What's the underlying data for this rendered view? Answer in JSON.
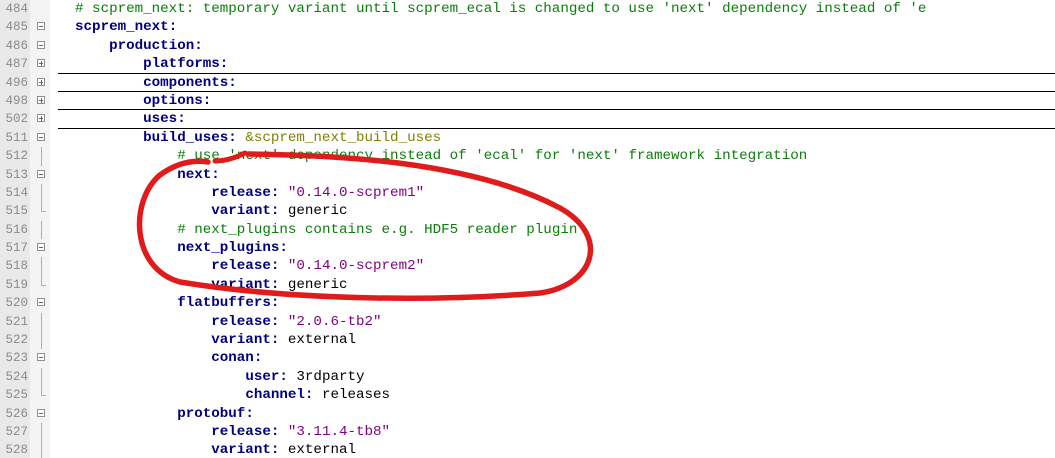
{
  "editor": {
    "lines": [
      {
        "num": "484",
        "fold": "none",
        "folded": false,
        "indent": 2,
        "segments": [
          {
            "t": "# scprem_next: temporary variant until scprem_ecal is changed to use 'next' dependency instead of 'e",
            "c": "c"
          }
        ]
      },
      {
        "num": "485",
        "fold": "open",
        "folded": false,
        "indent": 2,
        "segments": [
          {
            "t": "scprem_next",
            "c": "k"
          },
          {
            "t": ":",
            "c": "k"
          }
        ]
      },
      {
        "num": "486",
        "fold": "open",
        "folded": false,
        "indent": 6,
        "segments": [
          {
            "t": "production",
            "c": "k"
          },
          {
            "t": ":",
            "c": "k"
          }
        ]
      },
      {
        "num": "487",
        "fold": "closed",
        "folded": true,
        "indent": 10,
        "segments": [
          {
            "t": "platforms",
            "c": "k"
          },
          {
            "t": ":",
            "c": "k"
          }
        ]
      },
      {
        "num": "496",
        "fold": "closed",
        "folded": true,
        "indent": 10,
        "segments": [
          {
            "t": "components",
            "c": "k"
          },
          {
            "t": ":",
            "c": "k"
          }
        ]
      },
      {
        "num": "498",
        "fold": "closed",
        "folded": true,
        "indent": 10,
        "segments": [
          {
            "t": "options",
            "c": "k"
          },
          {
            "t": ":",
            "c": "k"
          }
        ]
      },
      {
        "num": "502",
        "fold": "closed",
        "folded": true,
        "indent": 10,
        "segments": [
          {
            "t": "uses",
            "c": "k"
          },
          {
            "t": ":",
            "c": "k"
          }
        ]
      },
      {
        "num": "511",
        "fold": "open",
        "folded": false,
        "indent": 10,
        "segments": [
          {
            "t": "build_uses",
            "c": "k"
          },
          {
            "t": ": ",
            "c": "k"
          },
          {
            "t": "&scprem_next_build_uses",
            "c": "a"
          }
        ]
      },
      {
        "num": "512",
        "fold": "none",
        "folded": false,
        "indent": 14,
        "segments": [
          {
            "t": "# use 'next' dependency instead of 'ecal' for 'next' framework integration",
            "c": "c"
          }
        ]
      },
      {
        "num": "513",
        "fold": "open",
        "folded": false,
        "indent": 14,
        "segments": [
          {
            "t": "next",
            "c": "k"
          },
          {
            "t": ":",
            "c": "k"
          }
        ]
      },
      {
        "num": "514",
        "fold": "none",
        "folded": false,
        "indent": 18,
        "segments": [
          {
            "t": "release",
            "c": "k"
          },
          {
            "t": ": ",
            "c": "k"
          },
          {
            "t": "\"0.14.0-scprem1\"",
            "c": "s"
          }
        ]
      },
      {
        "num": "515",
        "fold": "end",
        "folded": false,
        "indent": 18,
        "segments": [
          {
            "t": "variant",
            "c": "k"
          },
          {
            "t": ": ",
            "c": "k"
          },
          {
            "t": "generic",
            "c": "v"
          }
        ]
      },
      {
        "num": "516",
        "fold": "none",
        "folded": false,
        "indent": 14,
        "segments": [
          {
            "t": "# next_plugins contains e.g. HDF5 reader plugin",
            "c": "c"
          }
        ]
      },
      {
        "num": "517",
        "fold": "open",
        "folded": false,
        "indent": 14,
        "segments": [
          {
            "t": "next_plugins",
            "c": "k"
          },
          {
            "t": ":",
            "c": "k"
          }
        ]
      },
      {
        "num": "518",
        "fold": "none",
        "folded": false,
        "indent": 18,
        "segments": [
          {
            "t": "release",
            "c": "k"
          },
          {
            "t": ": ",
            "c": "k"
          },
          {
            "t": "\"0.14.0-scprem2\"",
            "c": "s"
          }
        ]
      },
      {
        "num": "519",
        "fold": "end",
        "folded": false,
        "indent": 18,
        "segments": [
          {
            "t": "variant",
            "c": "k"
          },
          {
            "t": ": ",
            "c": "k"
          },
          {
            "t": "generic",
            "c": "v"
          }
        ]
      },
      {
        "num": "520",
        "fold": "open",
        "folded": false,
        "indent": 14,
        "segments": [
          {
            "t": "flatbuffers",
            "c": "k"
          },
          {
            "t": ":",
            "c": "k"
          }
        ]
      },
      {
        "num": "521",
        "fold": "none",
        "folded": false,
        "indent": 18,
        "segments": [
          {
            "t": "release",
            "c": "k"
          },
          {
            "t": ": ",
            "c": "k"
          },
          {
            "t": "\"2.0.6-tb2\"",
            "c": "s"
          }
        ]
      },
      {
        "num": "522",
        "fold": "none",
        "folded": false,
        "indent": 18,
        "segments": [
          {
            "t": "variant",
            "c": "k"
          },
          {
            "t": ": ",
            "c": "k"
          },
          {
            "t": "external",
            "c": "v"
          }
        ]
      },
      {
        "num": "523",
        "fold": "open",
        "folded": false,
        "indent": 18,
        "segments": [
          {
            "t": "conan",
            "c": "k"
          },
          {
            "t": ":",
            "c": "k"
          }
        ]
      },
      {
        "num": "524",
        "fold": "none",
        "folded": false,
        "indent": 22,
        "segments": [
          {
            "t": "user",
            "c": "k"
          },
          {
            "t": ": ",
            "c": "k"
          },
          {
            "t": "3rdparty",
            "c": "v"
          }
        ]
      },
      {
        "num": "525",
        "fold": "end",
        "folded": false,
        "indent": 22,
        "segments": [
          {
            "t": "channel",
            "c": "k"
          },
          {
            "t": ": ",
            "c": "k"
          },
          {
            "t": "releases",
            "c": "v"
          }
        ]
      },
      {
        "num": "526",
        "fold": "open",
        "folded": false,
        "indent": 14,
        "segments": [
          {
            "t": "protobuf",
            "c": "k"
          },
          {
            "t": ":",
            "c": "k"
          }
        ]
      },
      {
        "num": "527",
        "fold": "none",
        "folded": false,
        "indent": 18,
        "segments": [
          {
            "t": "release",
            "c": "k"
          },
          {
            "t": ": ",
            "c": "k"
          },
          {
            "t": "\"3.11.4-tb8\"",
            "c": "s"
          }
        ]
      },
      {
        "num": "528",
        "fold": "none",
        "folded": false,
        "indent": 18,
        "segments": [
          {
            "t": "variant",
            "c": "k"
          },
          {
            "t": ": ",
            "c": "k"
          },
          {
            "t": "external",
            "c": "v"
          }
        ]
      }
    ]
  },
  "colors": {
    "keyword": "#00007f",
    "string": "#7f007f",
    "comment": "#0b7d0b",
    "anchor": "#808000",
    "annotation": "#e01b1b"
  },
  "icons": {
    "fold_open": "fold-minus-icon",
    "fold_closed": "fold-plus-icon"
  }
}
